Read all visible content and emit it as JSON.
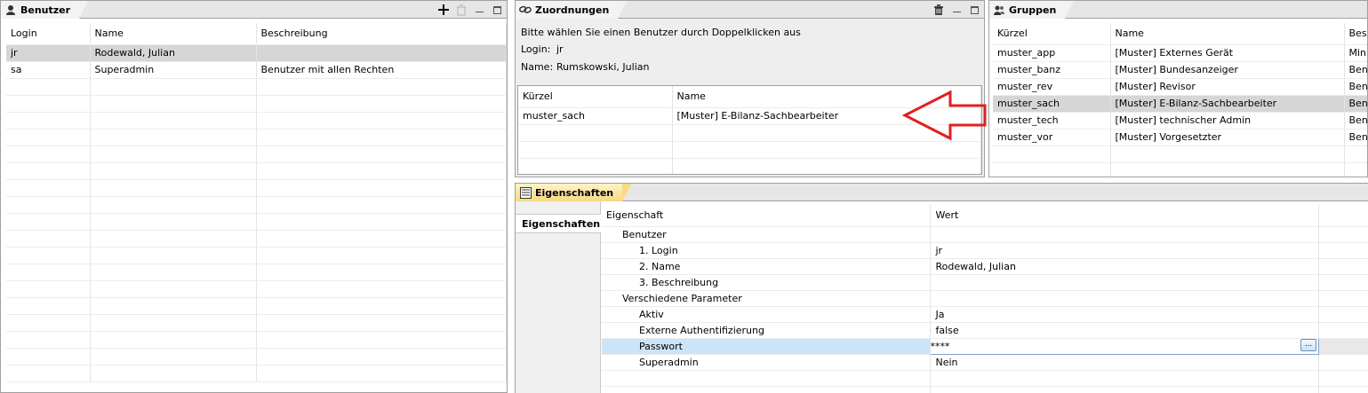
{
  "benutzer": {
    "title": "Benutzer",
    "columns": [
      "Login",
      "Name",
      "Beschreibung"
    ],
    "rows": [
      {
        "login": "jr",
        "name": "Rodewald, Julian",
        "beschreibung": ""
      },
      {
        "login": "sa",
        "name": "Superadmin",
        "beschreibung": "Benutzer mit allen Rechten"
      }
    ]
  },
  "zuordnungen": {
    "title": "Zuordnungen",
    "hint": "Bitte wählen Sie einen Benutzer durch Doppelklicken aus",
    "login_label": "Login:",
    "login_value": "jr",
    "name_label": "Name:",
    "name_value": "Rumskowski, Julian",
    "columns": [
      "Kürzel",
      "Name"
    ],
    "rows": [
      {
        "kuerzel": "muster_sach",
        "name": "[Muster] E-Bilanz-Sachbearbeiter"
      }
    ]
  },
  "gruppen": {
    "title": "Gruppen",
    "columns": [
      "Kürzel",
      "Name",
      "Besc"
    ],
    "rows": [
      {
        "kuerzel": "muster_app",
        "name": "[Muster] Externes Gerät",
        "desc": "Min"
      },
      {
        "kuerzel": "muster_banz",
        "name": "[Muster] Bundesanzeiger",
        "desc": "Ben"
      },
      {
        "kuerzel": "muster_rev",
        "name": "[Muster] Revisor",
        "desc": "Ben"
      },
      {
        "kuerzel": "muster_sach",
        "name": "[Muster] E-Bilanz-Sachbearbeiter",
        "desc": "Ben"
      },
      {
        "kuerzel": "muster_tech",
        "name": "[Muster] technischer Admin",
        "desc": "Ben"
      },
      {
        "kuerzel": "muster_vor",
        "name": "[Muster] Vorgesetzter",
        "desc": "Ben"
      }
    ],
    "selected_index": 3
  },
  "eigenschaften": {
    "title": "Eigenschaften",
    "side_tab": "Eigenschaften",
    "columns": [
      "Eigenschaft",
      "Wert"
    ],
    "rows": [
      {
        "label": "Benutzer",
        "value": ""
      },
      {
        "label": "1. Login",
        "value": "jr"
      },
      {
        "label": "2. Name",
        "value": "Rodewald, Julian"
      },
      {
        "label": "3. Beschreibung",
        "value": ""
      },
      {
        "label": "Verschiedene Parameter",
        "value": ""
      },
      {
        "label": "Aktiv",
        "value": "Ja"
      },
      {
        "label": "Externe Authentifizierung",
        "value": "false"
      },
      {
        "label": "Passwort",
        "value": "****"
      },
      {
        "label": "Superadmin",
        "value": "Nein"
      }
    ],
    "ellipsis_label": "..."
  },
  "colors": {
    "arrow": "#e02020",
    "selection_gray": "#d6d6d6",
    "selection_blue": "#cce4f7",
    "active_tab": "#f6d982"
  },
  "icons": {
    "user_tab": "user-icon",
    "link_tab": "link-icon",
    "group_tab": "group-icon",
    "properties_tab": "properties-icon",
    "add": "plus-icon",
    "delete": "trash-icon",
    "minimize": "minimize-icon",
    "maximize": "maximize-icon"
  }
}
